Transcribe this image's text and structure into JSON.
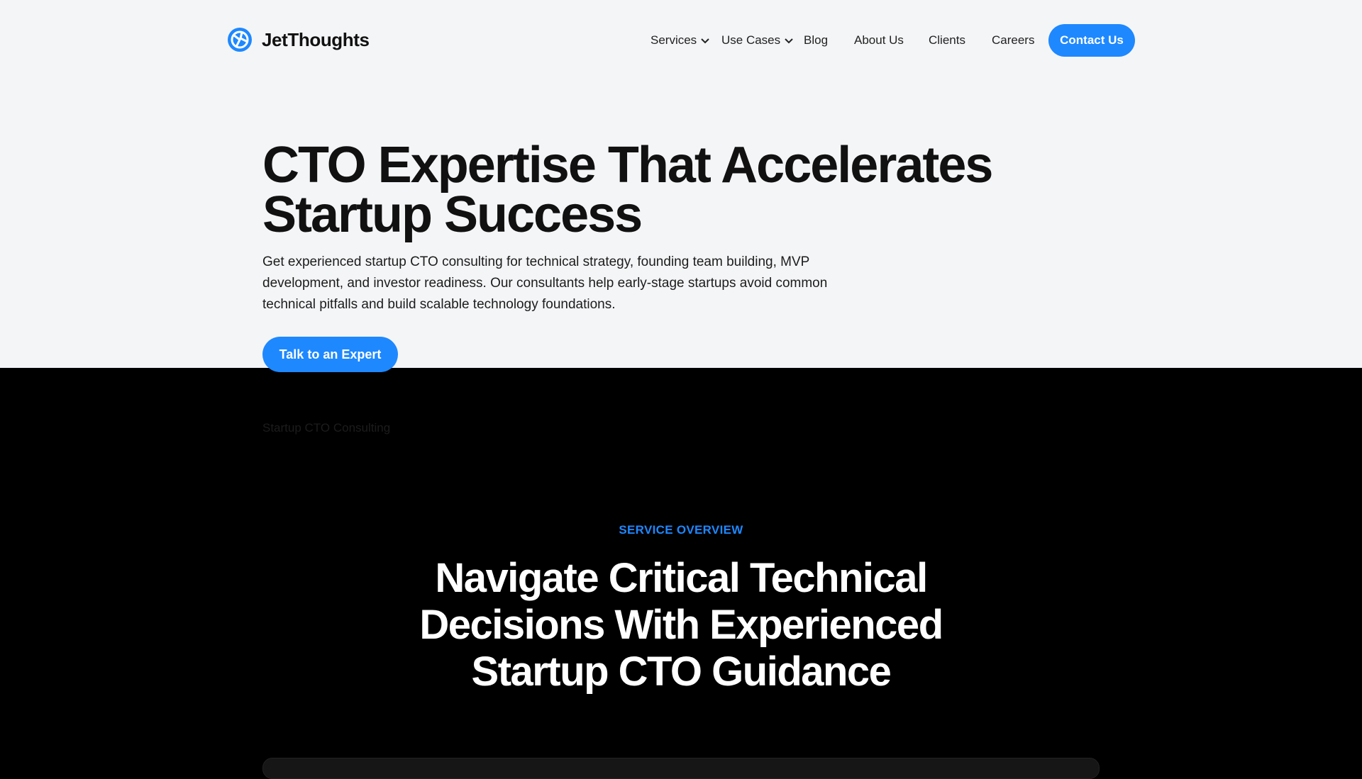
{
  "brand": {
    "name": "JetThoughts",
    "icon": "globe-logo-icon",
    "accent": "#1e88ff"
  },
  "nav": {
    "services": "Services",
    "use_cases": "Use Cases",
    "blog": "Blog",
    "about": "About Us",
    "clients": "Clients",
    "careers": "Careers",
    "contact": "Contact Us"
  },
  "hero": {
    "title_line1": "CTO Expertise That Accelerates",
    "title_line2": "Startup Success",
    "description": "Get experienced startup CTO consulting for technical strategy, founding team building, MVP development, and investor readiness. Our consultants help early-stage startups avoid common technical pitfalls and build scalable technology foundations.",
    "cta": "Talk to an Expert",
    "faint_label": "Startup CTO Consulting"
  },
  "overview": {
    "eyebrow": "SERVICE OVERVIEW",
    "title_line1": "Navigate Critical Technical",
    "title_line2": "Decisions With Experienced",
    "title_line3": "Startup CTO Guidance"
  }
}
